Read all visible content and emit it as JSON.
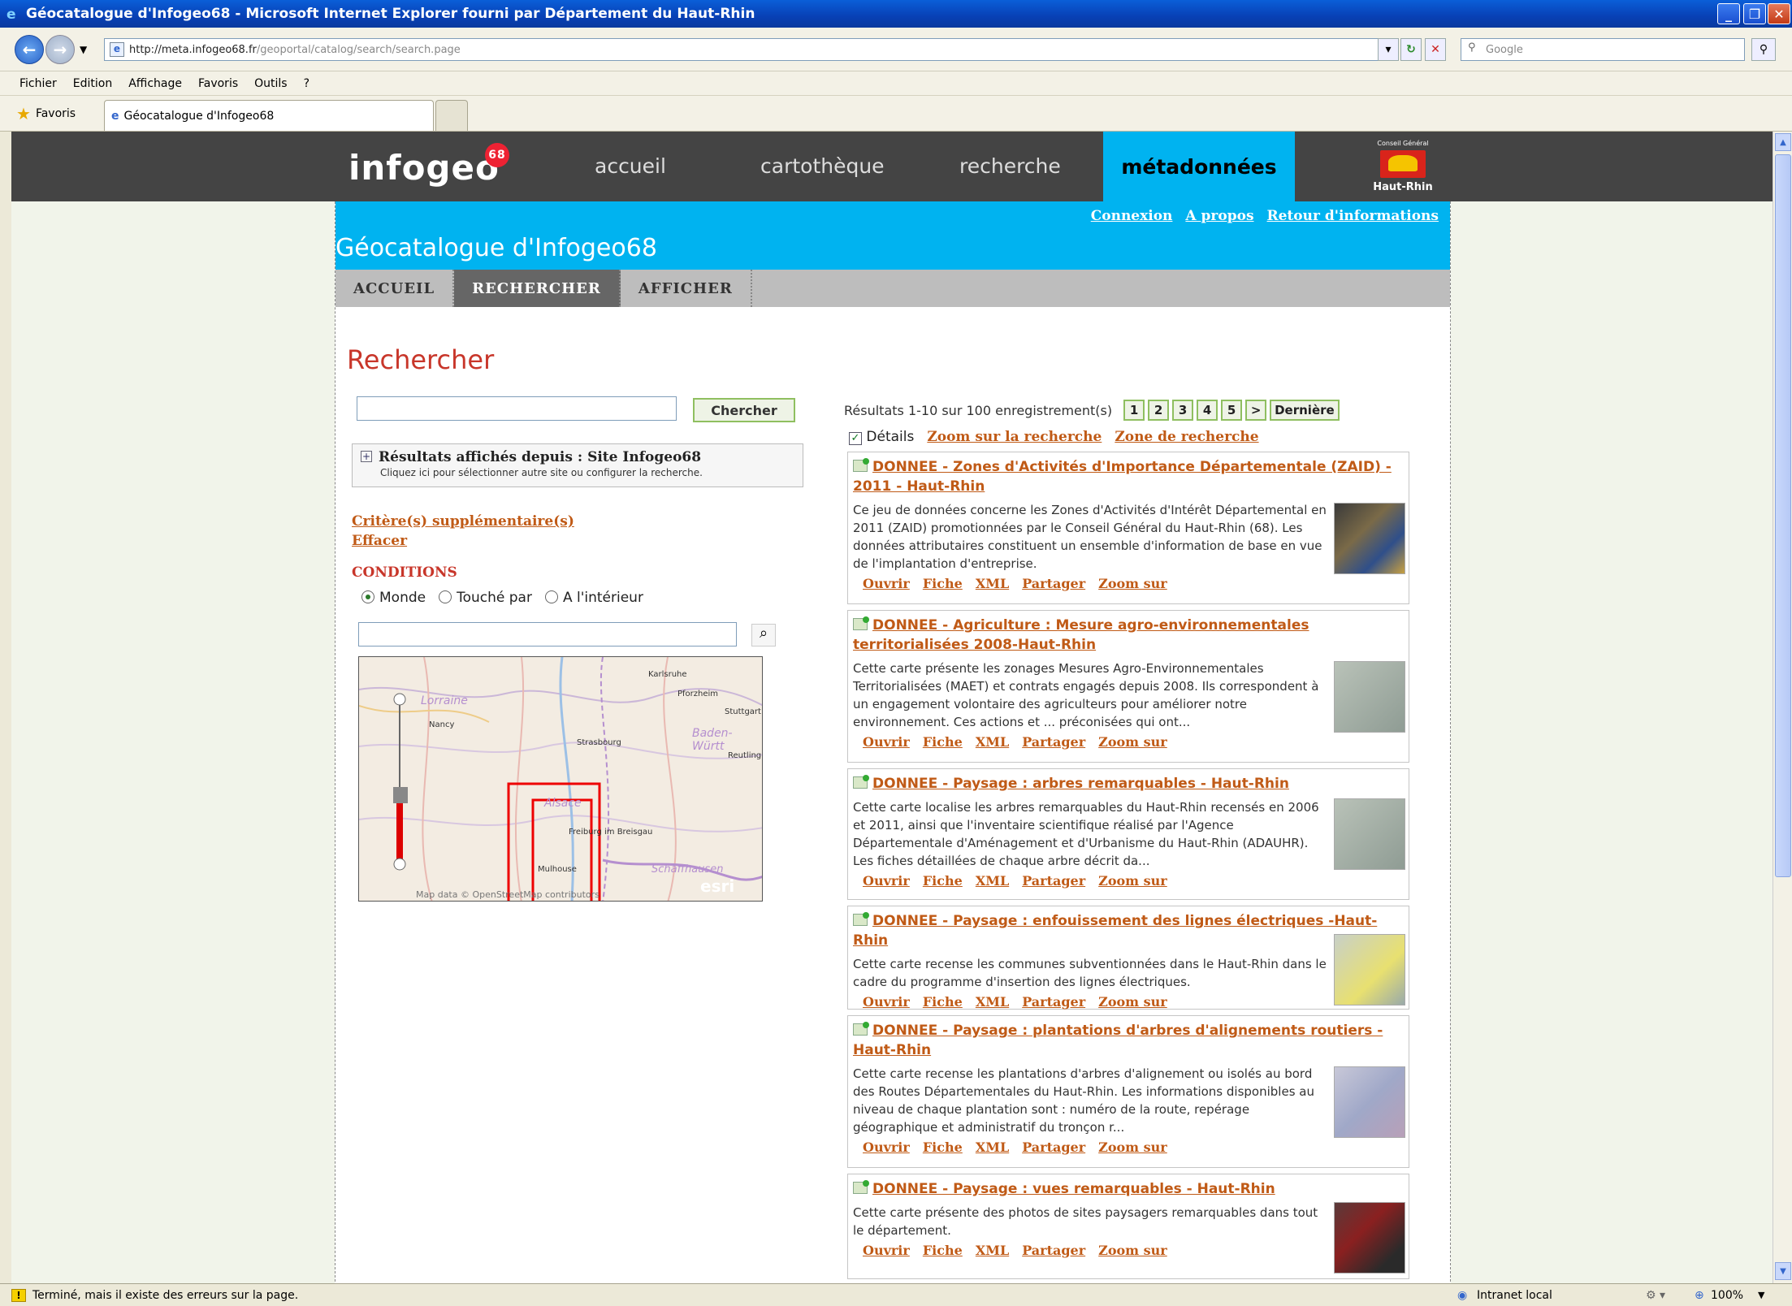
{
  "browser": {
    "title": "Géocatalogue d'Infogeo68 - Microsoft Internet Explorer fourni par Département du Haut-Rhin",
    "url_host": "http://meta.infogeo68.fr",
    "url_path": "/geoportal/catalog/search/search.page",
    "search_placeholder": "Google",
    "menu": [
      "Fichier",
      "Edition",
      "Affichage",
      "Favoris",
      "Outils",
      "?"
    ],
    "favorites_label": "Favoris",
    "tab_title": "Géocatalogue d'Infogeo68",
    "status_text": "Terminé, mais il existe des erreurs sur la page.",
    "zone": "Intranet local",
    "zoom": "100%"
  },
  "site": {
    "logo": "infogeo",
    "logo_badge": "68",
    "nav": [
      "accueil",
      "cartothèque",
      "recherche",
      "métadonnées"
    ],
    "council_small": "Conseil Général",
    "council_name": "Haut-Rhin",
    "top_links": [
      "Connexion",
      "A propos",
      "Retour d'informations"
    ],
    "catalog_title": "Géocatalogue d'Infogeo68",
    "subnav": [
      "ACCUEIL",
      "RECHERCHER",
      "AFFICHER"
    ],
    "page_heading": "Rechercher"
  },
  "search": {
    "button": "Chercher",
    "results_from": "Résultats affichés depuis : Site Infogeo68",
    "results_from_sub": "Cliquez ici pour sélectionner autre site ou configurer la recherche.",
    "criteria_link": "Critère(s) supplémentaire(s)",
    "clear_link": "Effacer",
    "conditions": "CONDITIONS",
    "radio_options": [
      "Monde",
      "Touché par",
      "A l'intérieur"
    ],
    "map_labels": [
      "Lorraine",
      "Nancy",
      "Karlsruhe",
      "Pforzheim",
      "Stuttgart",
      "Baden-Württ",
      "Strasbourg",
      "Reutling",
      "Alsace",
      "Freiburg im Breisgau",
      "Mulhouse",
      "Schaffhausen",
      "esri"
    ],
    "map_attribution": "Map data © OpenStreetMap contributors"
  },
  "results": {
    "summary": "Résultats 1-10 sur 100 enregistrement(s)",
    "pages": [
      "1",
      "2",
      "3",
      "4",
      "5",
      ">",
      "Dernière"
    ],
    "details_label": "Détails",
    "zoom_link": "Zoom sur la recherche",
    "zone_link": "Zone de recherche",
    "actions": [
      "Ouvrir",
      "Fiche",
      "XML",
      "Partager",
      "Zoom sur"
    ],
    "items": [
      {
        "title": "DONNEE - Zones d'Activités d'Importance Départementale (ZAID) - 2011 - Haut-Rhin",
        "desc": "Ce jeu de données concerne les Zones d'Activités d'Intérêt Départemental en 2011 (ZAID) promotionnées par le Conseil Général du Haut-Rhin (68). Les données attributaires constituent un ensemble d'information de base en vue de l'implantation d'entreprise."
      },
      {
        "title": "DONNEE - Agriculture : Mesure agro-environnementales territorialisées 2008-Haut-Rhin",
        "desc": "Cette carte présente les zonages Mesures Agro-Environnementales Territorialisées (MAET) et contrats engagés depuis 2008. Ils correspondent à un engagement volontaire des agriculteurs pour améliorer notre environnement. Ces actions et ... préconisées qui ont..."
      },
      {
        "title": "DONNEE - Paysage : arbres remarquables - Haut-Rhin",
        "desc": "Cette carte localise les arbres remarquables du Haut-Rhin recensés en 2006 et 2011, ainsi que l'inventaire scientifique réalisé par l'Agence Départementale d'Aménagement et d'Urbanisme du Haut-Rhin (ADAUHR). Les fiches détaillées de chaque arbre décrit da..."
      },
      {
        "title": "DONNEE - Paysage : enfouissement des lignes électriques -Haut-Rhin",
        "desc": "Cette carte recense les communes subventionnées dans le Haut-Rhin dans le cadre du programme d'insertion des lignes électriques."
      },
      {
        "title": "DONNEE - Paysage : plantations d'arbres d'alignements routiers - Haut-Rhin",
        "desc": "Cette carte recense les plantations d'arbres d'alignement ou isolés au bord des Routes Départementales du Haut-Rhin. Les informations disponibles au niveau de chaque plantation sont : numéro de la route, repérage géographique et administratif du tronçon r..."
      },
      {
        "title": "DONNEE - Paysage : vues remarquables - Haut-Rhin",
        "desc": "Cette carte présente des photos de sites paysagers remarquables dans tout le département."
      }
    ]
  }
}
